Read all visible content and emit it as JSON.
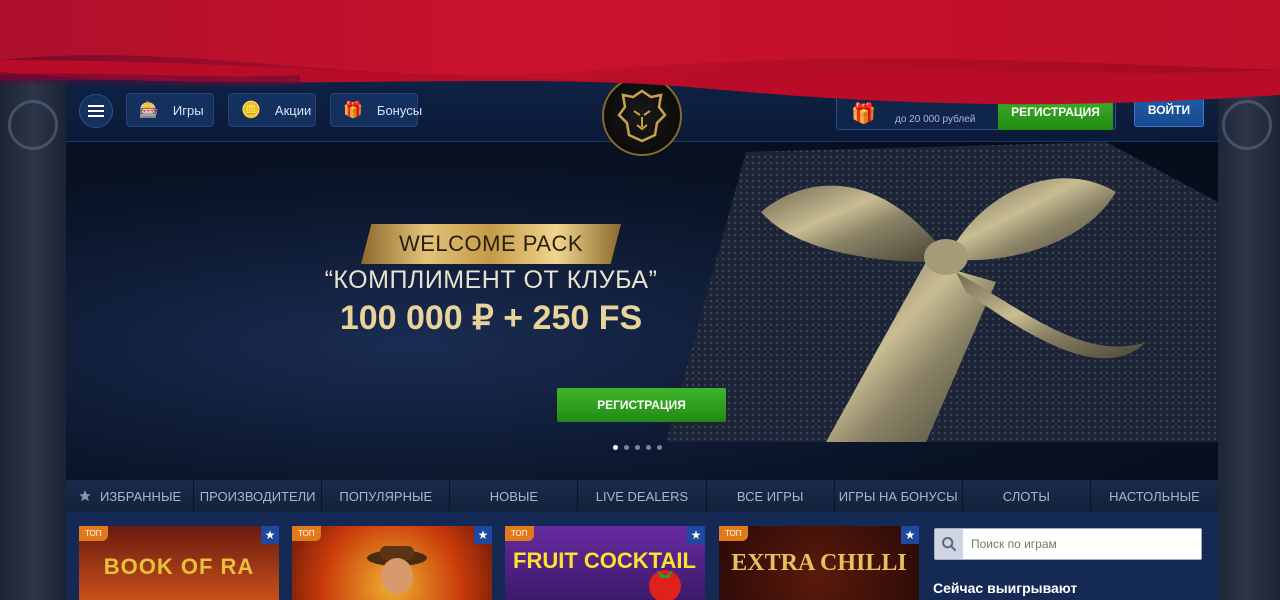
{
  "header": {
    "menu_icon": "hamburger-icon",
    "nav": [
      {
        "label": "Игры",
        "icon": "slot-machine-icon"
      },
      {
        "label": "Акции",
        "icon": "coin-icon"
      },
      {
        "label": "Бонусы",
        "icon": "gift-icon"
      }
    ],
    "logo_icon": "lion-logo-icon",
    "bonus": {
      "amount_sub": "до 20 000 рублей",
      "icon": "gift-stack-icon"
    },
    "register_label": "РЕГИСТРАЦИЯ",
    "login_label": "ВОЙТИ"
  },
  "banner": {
    "ribbon_text": "WELCOME PACK",
    "subtitle": "“КОМПЛИМЕНТ ОТ КЛУБА”",
    "headline": "100 000 ₽ + 250 FS",
    "register_label": "РЕГИСТРАЦИЯ",
    "slides_total": 5,
    "active_slide": 1
  },
  "categories": [
    {
      "label": "ИЗБРАННЫЕ",
      "icon": "star-icon"
    },
    {
      "label": "ПРОИЗВОДИТЕЛИ"
    },
    {
      "label": "ПОПУЛЯРНЫЕ"
    },
    {
      "label": "НОВЫЕ"
    },
    {
      "label": "LIVE DEALERS"
    },
    {
      "label": "ВСЕ ИГРЫ"
    },
    {
      "label": "ИГРЫ НА БОНУСЫ"
    },
    {
      "label": "СЛОТЫ"
    },
    {
      "label": "НАСТОЛЬНЫЕ"
    }
  ],
  "games": [
    {
      "title": "BOOK OF RA",
      "badge": "ТОП"
    },
    {
      "title": "",
      "badge": "ТОП"
    },
    {
      "title": "FRUIT COCKTAIL",
      "badge": "ТОП"
    },
    {
      "title": "EXTRA CHILLI",
      "badge": "ТОП"
    }
  ],
  "search": {
    "placeholder": "Поиск по играм"
  },
  "winning_title": "Сейчас выигрывают",
  "colors": {
    "accent_green": "#2fa01f",
    "accent_blue": "#1f5fad",
    "brand_red": "#c0102a",
    "badge_orange": "#e07a1a"
  }
}
